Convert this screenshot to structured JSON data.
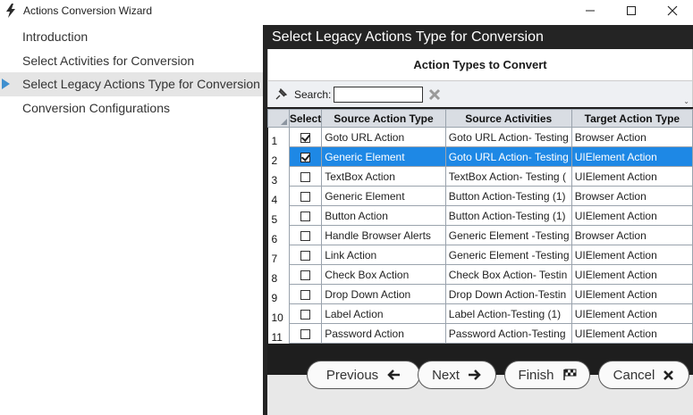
{
  "window": {
    "title": "Actions Conversion Wizard",
    "minimize": "—",
    "maximize": "☐",
    "close": "✕"
  },
  "nav": {
    "items": [
      {
        "label": "Introduction"
      },
      {
        "label": "Select Activities for Conversion"
      },
      {
        "label": "Select Legacy Actions Type for Conversion"
      },
      {
        "label": "Conversion Configurations"
      }
    ],
    "selected_index": 2
  },
  "panel": {
    "header": "Select Legacy Actions Type for Conversion",
    "subheader": "Action Types to Convert"
  },
  "toolbar": {
    "search_label": "Search:",
    "search_value": ""
  },
  "grid": {
    "columns": [
      "Select",
      "Source Action Type",
      "Source Activities",
      "Target Action Type"
    ],
    "rows": [
      {
        "num": "1",
        "checked": true,
        "source_type": "Goto URL Action",
        "source_activities": "Goto URL Action- Testing",
        "target_type": "Browser Action"
      },
      {
        "num": "2",
        "checked": true,
        "source_type": "Generic Element",
        "source_activities": "Goto URL Action- Testing",
        "target_type": "UIElement Action"
      },
      {
        "num": "3",
        "checked": false,
        "source_type": "TextBox Action",
        "source_activities": "TextBox Action- Testing (",
        "target_type": "UIElement Action"
      },
      {
        "num": "4",
        "checked": false,
        "source_type": "Generic Element",
        "source_activities": "Button Action-Testing (1)",
        "target_type": "Browser Action"
      },
      {
        "num": "5",
        "checked": false,
        "source_type": "Button Action",
        "source_activities": "Button Action-Testing (1)",
        "target_type": "UIElement Action"
      },
      {
        "num": "6",
        "checked": false,
        "source_type": "Handle Browser Alerts",
        "source_activities": "Generic Element -Testing",
        "target_type": "Browser Action"
      },
      {
        "num": "7",
        "checked": false,
        "source_type": "Link Action",
        "source_activities": "Generic Element -Testing",
        "target_type": "UIElement Action"
      },
      {
        "num": "8",
        "checked": false,
        "source_type": "Check Box Action",
        "source_activities": "Check Box Action- Testin",
        "target_type": "UIElement Action"
      },
      {
        "num": "9",
        "checked": false,
        "source_type": "Drop Down Action",
        "source_activities": "Drop Down Action-Testin",
        "target_type": "UIElement Action"
      },
      {
        "num": "10",
        "checked": false,
        "source_type": "Label Action",
        "source_activities": "Label Action-Testing (1)",
        "target_type": "UIElement Action"
      },
      {
        "num": "11",
        "checked": false,
        "source_type": "Password Action",
        "source_activities": "Password Action-Testing",
        "target_type": "UIElement Action"
      }
    ],
    "selected_row": 1
  },
  "footer": {
    "previous_label": "Previous",
    "next_label": "Next",
    "finish_label": "Finish",
    "cancel_label": "Cancel"
  },
  "colors": {
    "accent": "#1e88e5",
    "dark_header": "#242424",
    "nav_arrow": "#3f8fcf"
  }
}
